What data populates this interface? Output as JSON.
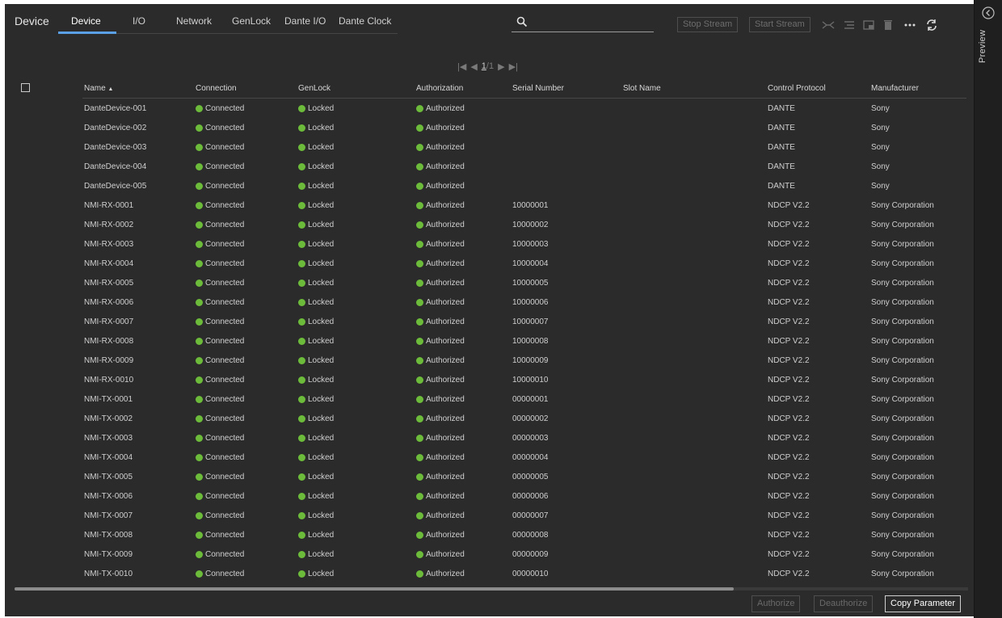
{
  "app": {
    "title": "Device"
  },
  "tabs": [
    {
      "label": "Device",
      "active": true
    },
    {
      "label": "I/O"
    },
    {
      "label": "Network"
    },
    {
      "label": "GenLock"
    },
    {
      "label": "Dante I/O"
    },
    {
      "label": "Dante Clock"
    }
  ],
  "search": {
    "value": "",
    "placeholder": "",
    "icon": "search-icon"
  },
  "toolbar": {
    "stop_stream": "Stop Stream",
    "start_stream": "Start Stream",
    "icons": [
      "connect-icon",
      "list-icon",
      "window-icon",
      "trash-icon",
      "more-icon",
      "refresh-icon"
    ]
  },
  "pagination": {
    "current": "1",
    "separator": "/",
    "total": "1"
  },
  "table": {
    "columns": [
      "Name",
      "Connection",
      "GenLock",
      "Authorization",
      "Serial Number",
      "Slot Name",
      "Control Protocol",
      "Manufacturer"
    ],
    "sort_indicator": "▲",
    "rows": [
      [
        "DanteDevice-001",
        "Connected",
        "Locked",
        "Authorized",
        "",
        "",
        "DANTE",
        "Sony"
      ],
      [
        "DanteDevice-002",
        "Connected",
        "Locked",
        "Authorized",
        "",
        "",
        "DANTE",
        "Sony"
      ],
      [
        "DanteDevice-003",
        "Connected",
        "Locked",
        "Authorized",
        "",
        "",
        "DANTE",
        "Sony"
      ],
      [
        "DanteDevice-004",
        "Connected",
        "Locked",
        "Authorized",
        "",
        "",
        "DANTE",
        "Sony"
      ],
      [
        "DanteDevice-005",
        "Connected",
        "Locked",
        "Authorized",
        "",
        "",
        "DANTE",
        "Sony"
      ],
      [
        "NMI-RX-0001",
        "Connected",
        "Locked",
        "Authorized",
        "10000001",
        "",
        "NDCP V2.2",
        "Sony Corporation"
      ],
      [
        "NMI-RX-0002",
        "Connected",
        "Locked",
        "Authorized",
        "10000002",
        "",
        "NDCP V2.2",
        "Sony Corporation"
      ],
      [
        "NMI-RX-0003",
        "Connected",
        "Locked",
        "Authorized",
        "10000003",
        "",
        "NDCP V2.2",
        "Sony Corporation"
      ],
      [
        "NMI-RX-0004",
        "Connected",
        "Locked",
        "Authorized",
        "10000004",
        "",
        "NDCP V2.2",
        "Sony Corporation"
      ],
      [
        "NMI-RX-0005",
        "Connected",
        "Locked",
        "Authorized",
        "10000005",
        "",
        "NDCP V2.2",
        "Sony Corporation"
      ],
      [
        "NMI-RX-0006",
        "Connected",
        "Locked",
        "Authorized",
        "10000006",
        "",
        "NDCP V2.2",
        "Sony Corporation"
      ],
      [
        "NMI-RX-0007",
        "Connected",
        "Locked",
        "Authorized",
        "10000007",
        "",
        "NDCP V2.2",
        "Sony Corporation"
      ],
      [
        "NMI-RX-0008",
        "Connected",
        "Locked",
        "Authorized",
        "10000008",
        "",
        "NDCP V2.2",
        "Sony Corporation"
      ],
      [
        "NMI-RX-0009",
        "Connected",
        "Locked",
        "Authorized",
        "10000009",
        "",
        "NDCP V2.2",
        "Sony Corporation"
      ],
      [
        "NMI-RX-0010",
        "Connected",
        "Locked",
        "Authorized",
        "10000010",
        "",
        "NDCP V2.2",
        "Sony Corporation"
      ],
      [
        "NMI-TX-0001",
        "Connected",
        "Locked",
        "Authorized",
        "00000001",
        "",
        "NDCP V2.2",
        "Sony Corporation"
      ],
      [
        "NMI-TX-0002",
        "Connected",
        "Locked",
        "Authorized",
        "00000002",
        "",
        "NDCP V2.2",
        "Sony Corporation"
      ],
      [
        "NMI-TX-0003",
        "Connected",
        "Locked",
        "Authorized",
        "00000003",
        "",
        "NDCP V2.2",
        "Sony Corporation"
      ],
      [
        "NMI-TX-0004",
        "Connected",
        "Locked",
        "Authorized",
        "00000004",
        "",
        "NDCP V2.2",
        "Sony Corporation"
      ],
      [
        "NMI-TX-0005",
        "Connected",
        "Locked",
        "Authorized",
        "00000005",
        "",
        "NDCP V2.2",
        "Sony Corporation"
      ],
      [
        "NMI-TX-0006",
        "Connected",
        "Locked",
        "Authorized",
        "00000006",
        "",
        "NDCP V2.2",
        "Sony Corporation"
      ],
      [
        "NMI-TX-0007",
        "Connected",
        "Locked",
        "Authorized",
        "00000007",
        "",
        "NDCP V2.2",
        "Sony Corporation"
      ],
      [
        "NMI-TX-0008",
        "Connected",
        "Locked",
        "Authorized",
        "00000008",
        "",
        "NDCP V2.2",
        "Sony Corporation"
      ],
      [
        "NMI-TX-0009",
        "Connected",
        "Locked",
        "Authorized",
        "00000009",
        "",
        "NDCP V2.2",
        "Sony Corporation"
      ],
      [
        "NMI-TX-0010",
        "Connected",
        "Locked",
        "Authorized",
        "00000010",
        "",
        "NDCP V2.2",
        "Sony Corporation"
      ]
    ]
  },
  "footer": {
    "authorize": "Authorize",
    "deauthorize": "Deauthorize",
    "copy_parameter": "Copy Parameter"
  },
  "side_panel": {
    "label": "Preview",
    "icon": "collapse-icon"
  },
  "colors": {
    "background": "#2b2b2b",
    "status_ok": "#6dbb3a",
    "accent": "#5aa0e6"
  }
}
